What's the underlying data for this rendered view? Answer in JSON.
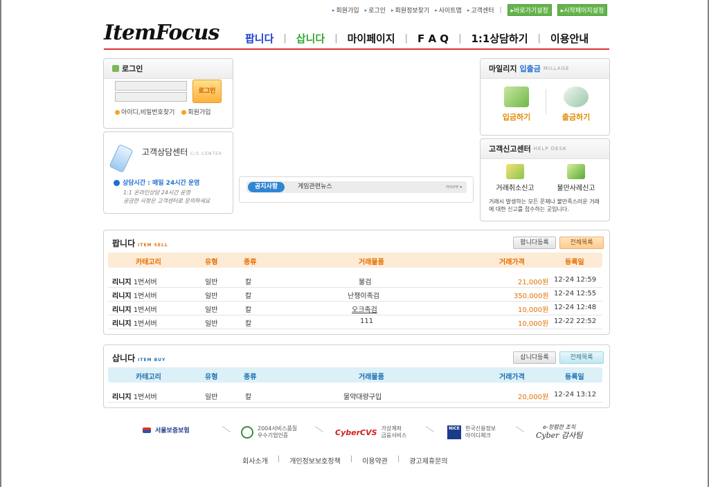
{
  "topnav": {
    "items": [
      "회원가입",
      "로그인",
      "회원정보찾기",
      "사이트맵",
      "고객센터"
    ],
    "btn_shortcut": "바로가기설정",
    "btn_home": "시작페이지설정"
  },
  "logo": {
    "text": "ItemFocus"
  },
  "mainnav": [
    "팝니다",
    "삽니다",
    "마이페이지",
    "F A Q",
    "1:1상담하기",
    "이용안내"
  ],
  "login": {
    "title": "로그인",
    "id_placeholder": "",
    "pw_placeholder": "",
    "button": "로그인",
    "find_link": "아이디,비밀번호찾기",
    "join_link": "회원가입"
  },
  "cs_center": {
    "title": "고객상담센터",
    "subtitle": "C/S CENTER",
    "hours": "상담시간 : 매일 24시간 운영",
    "line1": "1:1 온라인상담 24시간 운영",
    "line2": "궁금한 사항은 고객센터로 문의하세요"
  },
  "notice": {
    "tab_active": "공지사항",
    "tab_other": "게임관련뉴스",
    "more": "more ▸"
  },
  "mileage": {
    "title_plain": "마일리지",
    "title_accent": "입출금",
    "subtitle": "MILLAGE",
    "deposit": "입금하기",
    "withdraw": "출금하기"
  },
  "helpdesk": {
    "title": "고객신고센터",
    "subtitle": "HELP DESK",
    "cancel": "거래취소신고",
    "complaint": "불만사례신고",
    "desc": "거래시 발생하는 모든 문제나 불만족스러운 거래에 대한 신고를 접수하는 곳입니다."
  },
  "sell": {
    "title": "팝니다",
    "subtitle": "ITEM SELL",
    "btn_register": "팝니다등록",
    "btn_all": "전체목록",
    "headers": [
      "카테고리",
      "유형",
      "종류",
      "거래물품",
      "거래가격",
      "등록일"
    ],
    "rows": [
      {
        "game": "리니지",
        "server": "1번서버",
        "type": "일반",
        "kind": "칼",
        "item": "불검",
        "price": "21,000원",
        "date": "12-24 12:59"
      },
      {
        "game": "리니지",
        "server": "1번서버",
        "type": "일반",
        "kind": "칼",
        "item": "난쟁이족검",
        "price": "350,000원",
        "date": "12-24 12:55"
      },
      {
        "game": "리니지",
        "server": "1번서버",
        "type": "일반",
        "kind": "칼",
        "item": "오크족검",
        "price": "10,000원",
        "date": "12-24 12:48"
      },
      {
        "game": "리니지",
        "server": "1번서버",
        "type": "일반",
        "kind": "칼",
        "item": "111",
        "price": "10,000원",
        "date": "12-22 22:52"
      }
    ]
  },
  "buy": {
    "title": "삽니다",
    "subtitle": "ITEM BUY",
    "btn_register": "삽니다등록",
    "btn_all": "전체목록",
    "headers": [
      "카테고리",
      "유형",
      "종류",
      "거래물품",
      "거래가격",
      "등록일"
    ],
    "rows": [
      {
        "game": "리니지",
        "server": "1번서버",
        "type": "일반",
        "kind": "칼",
        "item": "물약대량구입",
        "price": "20,000원",
        "date": "12-24 13:12"
      }
    ]
  },
  "footer": {
    "partner1": "서울보증보험",
    "partner2_l1": "2004서비스품질",
    "partner2_l2": "우수기업인증",
    "partner3_logo": "CyberCVS",
    "partner3_l1": "가상계좌",
    "partner3_l2": "금융서비스",
    "partner4_logo": "NICE",
    "partner4_l1": "한국신용정보",
    "partner4_l2": "아이디체크",
    "partner5_l1": "e-청렴한 조직",
    "partner5_l2": "Cyber 감사팀",
    "links": [
      "회사소개",
      "개인정보보호정책",
      "이용약관",
      "광고제휴문의"
    ]
  },
  "colors": {
    "accent_red": "#e03030",
    "sell_orange": "#e56e00",
    "buy_blue": "#1c6fb0",
    "green_btn": "#64b44b"
  }
}
